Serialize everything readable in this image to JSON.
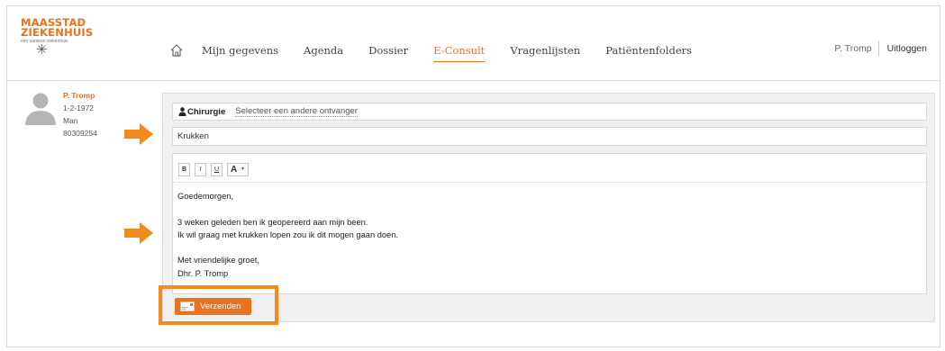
{
  "logo": {
    "line1": "MAASSTAD",
    "line2": "ZIEKENHUIS",
    "tagline": "een santeon ziekenhuis",
    "symbol": "✳"
  },
  "nav": {
    "home_icon": "home-icon",
    "items": [
      {
        "label": "Mijn gegevens"
      },
      {
        "label": "Agenda"
      },
      {
        "label": "Dossier"
      },
      {
        "label": "E-Consult"
      },
      {
        "label": "Vragenlijsten"
      },
      {
        "label": "Patiëntenfolders"
      }
    ],
    "active": "E-Consult"
  },
  "user": {
    "name": "P. Tromp",
    "logout": "Uitloggen"
  },
  "patient": {
    "name": "P. Tromp",
    "birthdate": "1-2-1972",
    "gender": "Man",
    "number": "80309254"
  },
  "message": {
    "recipient_icon": "person-icon",
    "recipient": "Chirurgie",
    "change_recipient": "Selecteer een andere ontvanger",
    "subject": "Krukken",
    "toolbar": {
      "bold": "B",
      "italic": "I",
      "underline": "U",
      "font_color": "A"
    },
    "body": {
      "line1": "Goedemorgen,",
      "line2": "3 weken geleden ben ik geopereerd aan mijn been.",
      "line3": "Ik wil graag met krukken lopen zou ik dit mogen gaan doen.",
      "line4": "Met vriendelijke groet,",
      "line5": "Dhr. P. Tromp"
    },
    "send_label": "Verzenden"
  },
  "colors": {
    "accent": "#e8731f",
    "highlight": "#f28a1e"
  }
}
